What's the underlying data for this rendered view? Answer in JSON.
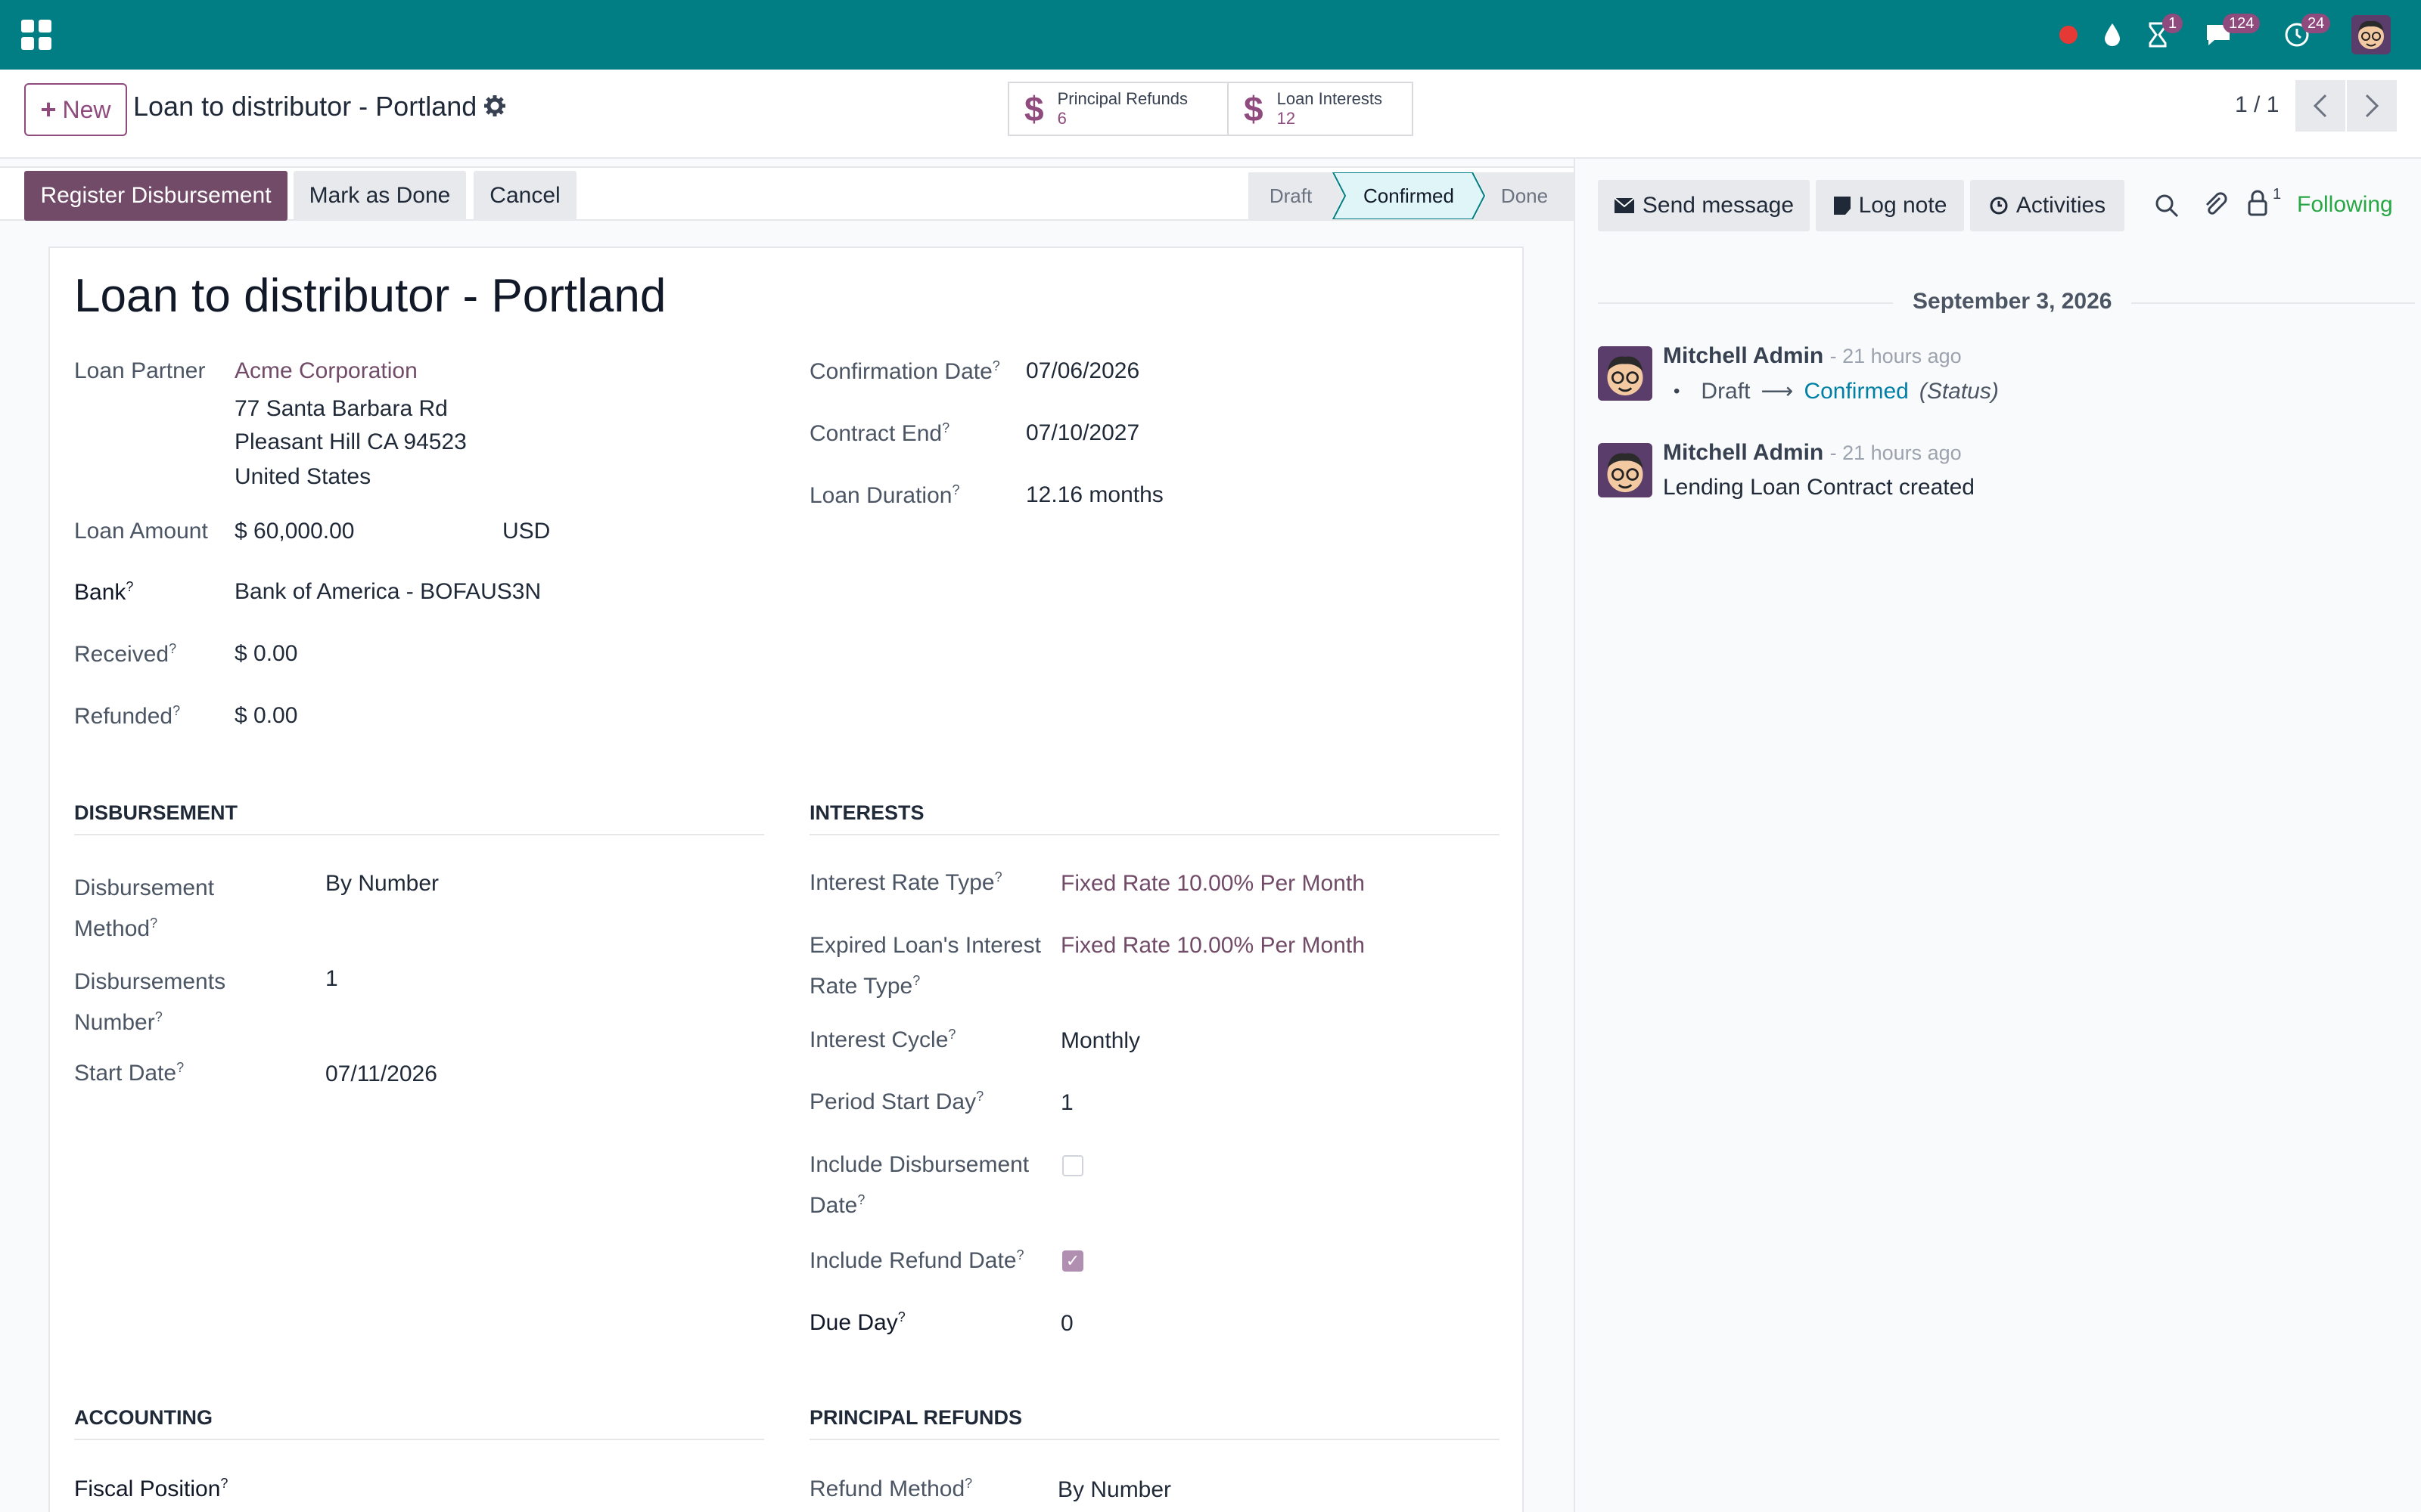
{
  "systray": {
    "activity_badge": "1",
    "messages_badge": "124",
    "clock_badge": "24"
  },
  "control": {
    "new_label": "New",
    "breadcrumb": "Loan to distributor - Portland",
    "smart_buttons": [
      {
        "label": "Principal Refunds",
        "count": "6"
      },
      {
        "label": "Loan Interests",
        "count": "12"
      }
    ],
    "pager": "1 / 1"
  },
  "actions": {
    "register": "Register Disbursement",
    "mark_done": "Mark as Done",
    "cancel": "Cancel"
  },
  "stages": [
    "Draft",
    "Confirmed",
    "Done"
  ],
  "stage_active": "Confirmed",
  "form": {
    "title": "Loan to distributor - Portland",
    "partner_label": "Loan Partner",
    "partner": "Acme Corporation",
    "address1": "77 Santa Barbara Rd",
    "address2": "Pleasant Hill CA 94523",
    "address3": "United States",
    "amount_label": "Loan Amount",
    "amount": "$ 60,000.00",
    "currency": "USD",
    "bank_label": "Bank",
    "bank": "Bank of America - BOFAUS3N",
    "received_label": "Received",
    "received": "$ 0.00",
    "refunded_label": "Refunded",
    "refunded": "$ 0.00",
    "confirm_label": "Confirmation Date",
    "confirm": "07/06/2026",
    "contract_end_label": "Contract End",
    "contract_end": "07/10/2027",
    "duration_label": "Loan Duration",
    "duration": "12.16 months",
    "disb_section": "DISBURSEMENT",
    "disb_method_label1": "Disbursement",
    "disb_method_label2": "Method",
    "disb_method": "By Number",
    "disb_number_label1": "Disbursements",
    "disb_number_label2": "Number",
    "disb_number": "1",
    "start_label": "Start Date",
    "start": "07/11/2026",
    "int_section": "INTERESTS",
    "rate_type_label": "Interest Rate Type",
    "rate_type": "Fixed Rate 10.00% Per Month",
    "expired_label1": "Expired Loan's Interest",
    "expired_label2": "Rate Type",
    "expired": "Fixed Rate 10.00% Per Month",
    "cycle_label": "Interest Cycle",
    "cycle": "Monthly",
    "period_label": "Period Start Day",
    "period": "1",
    "incl_disb_label1": "Include Disbursement",
    "incl_disb_label2": "Date",
    "incl_disb_checked": false,
    "incl_refund_label": "Include Refund Date",
    "incl_refund_checked": true,
    "due_label": "Due Day",
    "due": "0",
    "acc_section": "ACCOUNTING",
    "fiscal_label": "Fiscal Position",
    "pr_section": "PRINCIPAL REFUNDS",
    "refund_method_label": "Refund Method",
    "refund_method": "By Number"
  },
  "chatter": {
    "send": "Send message",
    "log": "Log note",
    "activities": "Activities",
    "followers_count": "1",
    "following": "Following",
    "date": "September 3, 2026",
    "messages": [
      {
        "author": "Mitchell Admin",
        "time": "- 21 hours ago",
        "from": "Draft",
        "to": "Confirmed",
        "field": "(Status)"
      },
      {
        "author": "Mitchell Admin",
        "time": "- 21 hours ago",
        "body": "Lending Loan Contract created"
      }
    ]
  },
  "colors": {
    "brand": "#017e84",
    "primary": "#714b67",
    "link": "#714b67",
    "following": "#28a745"
  }
}
